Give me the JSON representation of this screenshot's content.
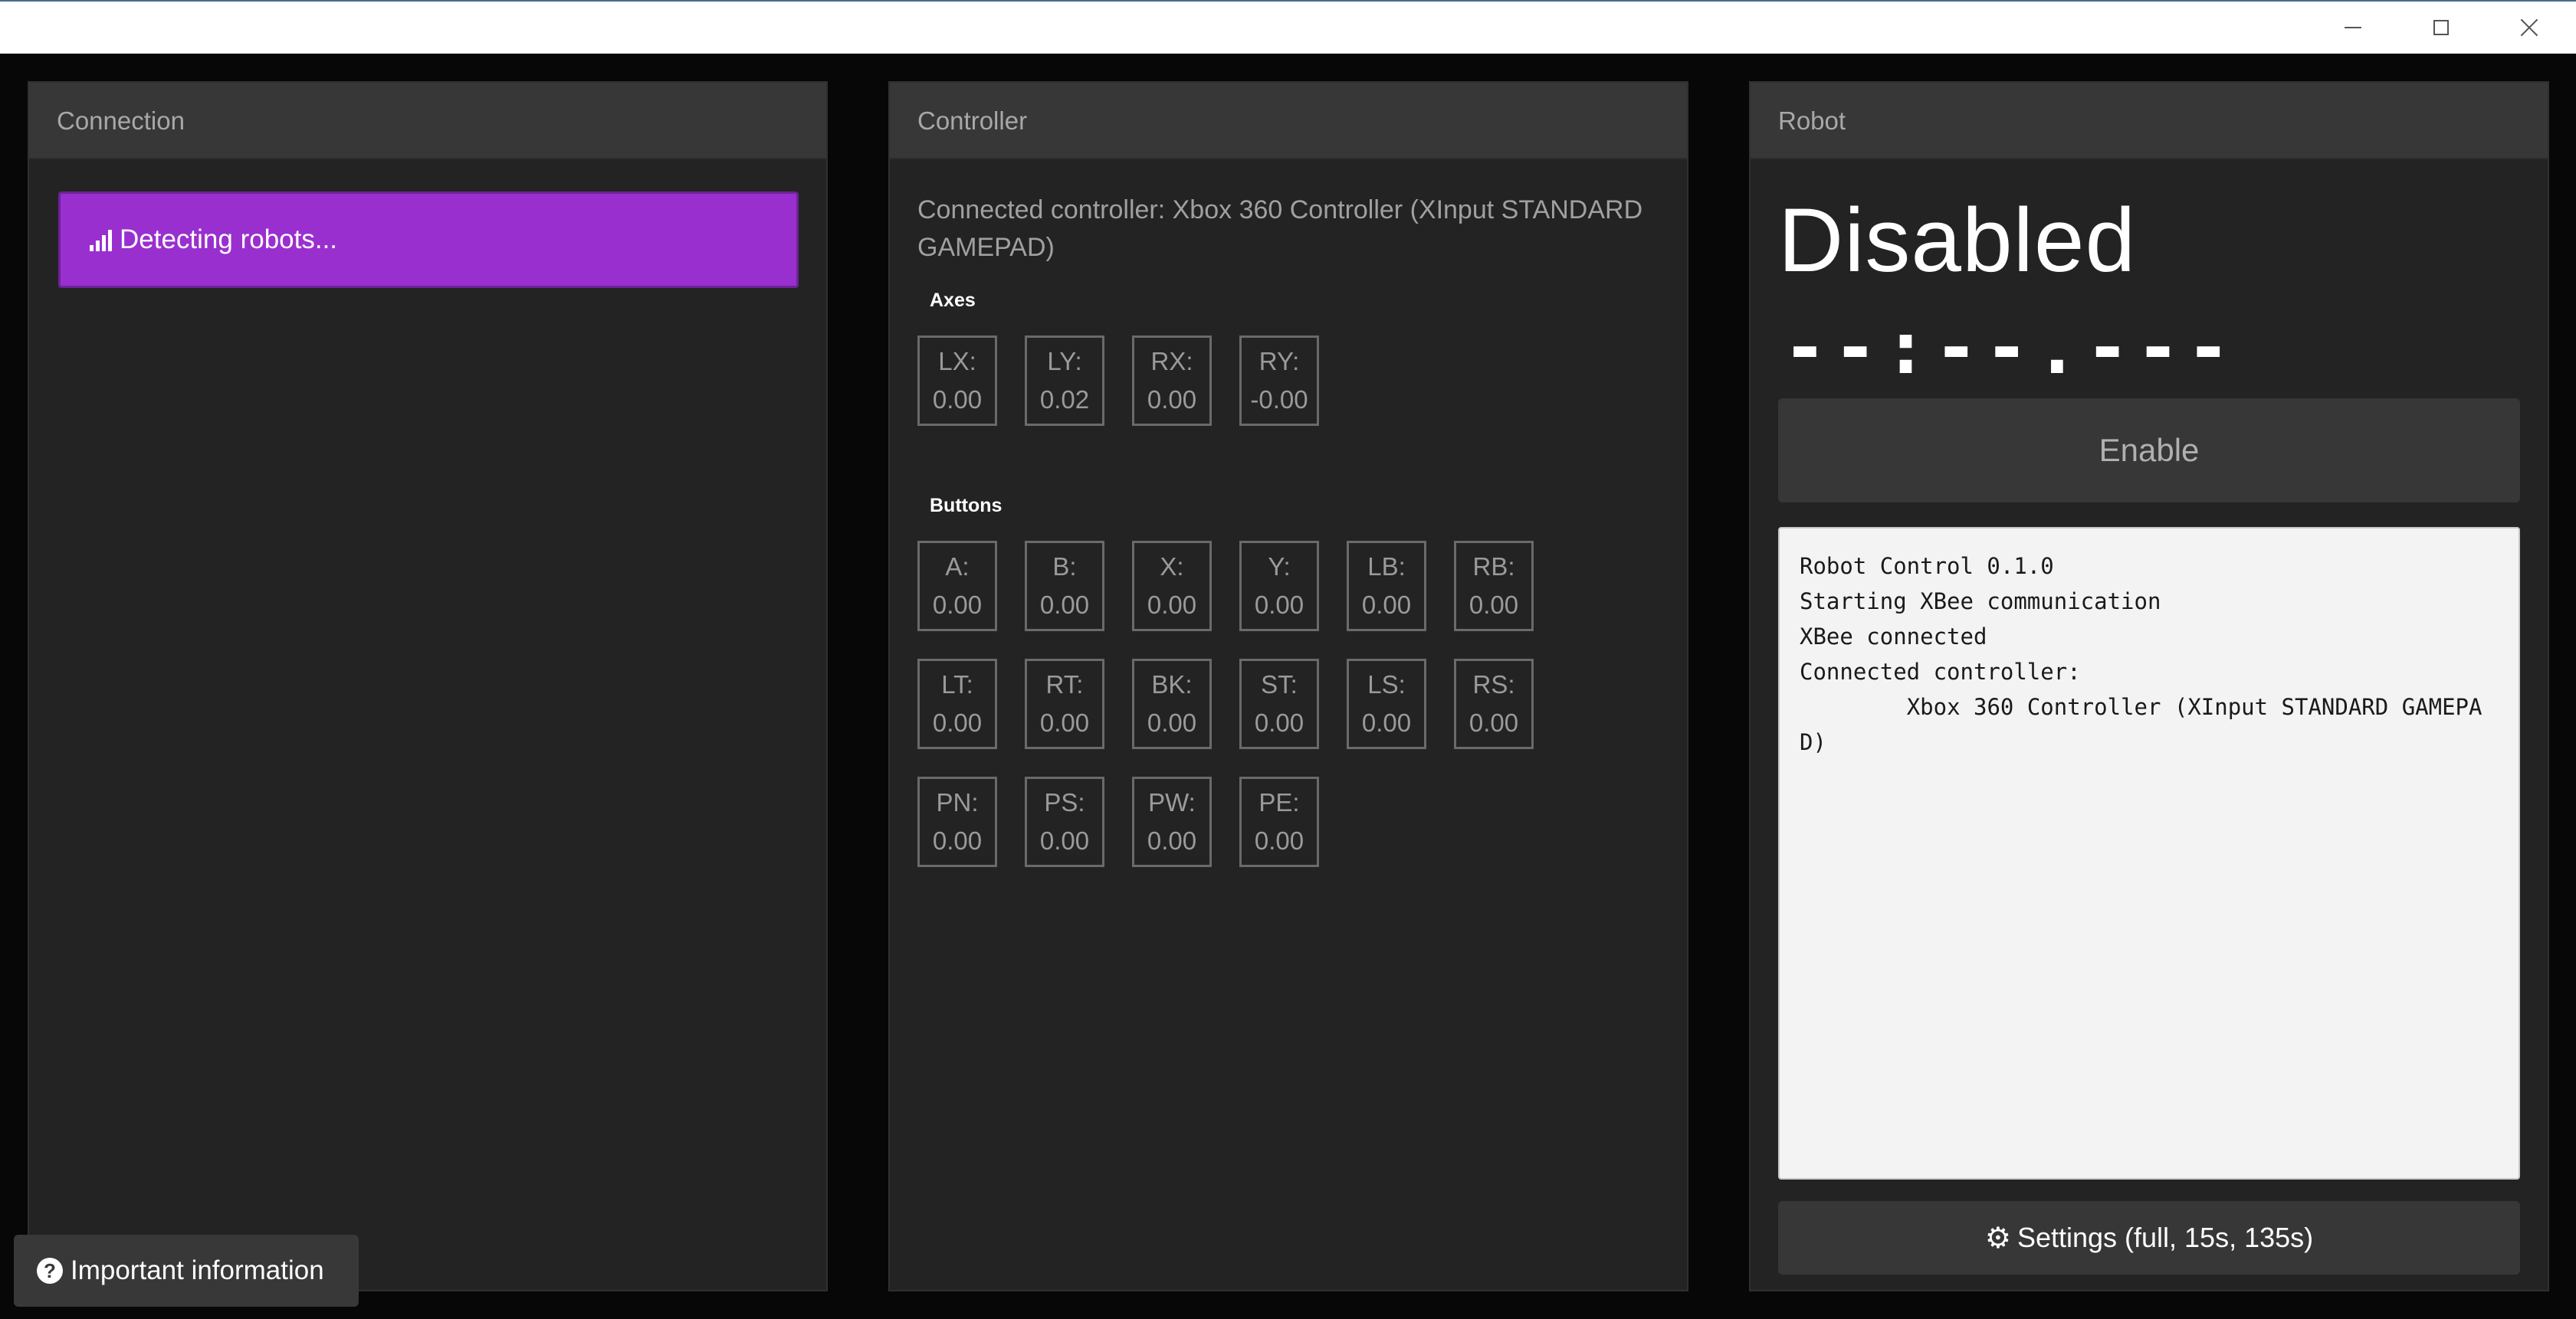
{
  "window": {
    "minimize_icon": "minimize-icon",
    "maximize_icon": "maximize-icon",
    "close_icon": "close-icon"
  },
  "connection": {
    "title": "Connection",
    "status_label": "Detecting robots...",
    "status_icon": "signal-bars-icon",
    "status_color": "#9a2fcf"
  },
  "controller": {
    "title": "Controller",
    "connected_text": "Connected controller: Xbox 360 Controller (XInput STANDARD GAMEPAD)",
    "axes_label": "Axes",
    "axes": [
      {
        "label": "LX:",
        "value": "0.00"
      },
      {
        "label": "LY:",
        "value": "0.02"
      },
      {
        "label": "RX:",
        "value": "0.00"
      },
      {
        "label": "RY:",
        "value": "-0.00"
      }
    ],
    "buttons_label": "Buttons",
    "buttons": [
      {
        "label": "A:",
        "value": "0.00"
      },
      {
        "label": "B:",
        "value": "0.00"
      },
      {
        "label": "X:",
        "value": "0.00"
      },
      {
        "label": "Y:",
        "value": "0.00"
      },
      {
        "label": "LB:",
        "value": "0.00"
      },
      {
        "label": "RB:",
        "value": "0.00"
      },
      {
        "label": "LT:",
        "value": "0.00"
      },
      {
        "label": "RT:",
        "value": "0.00"
      },
      {
        "label": "BK:",
        "value": "0.00"
      },
      {
        "label": "ST:",
        "value": "0.00"
      },
      {
        "label": "LS:",
        "value": "0.00"
      },
      {
        "label": "RS:",
        "value": "0.00"
      },
      {
        "label": "PN:",
        "value": "0.00"
      },
      {
        "label": "PS:",
        "value": "0.00"
      },
      {
        "label": "PW:",
        "value": "0.00"
      },
      {
        "label": "PE:",
        "value": "0.00"
      }
    ]
  },
  "robot": {
    "title": "Robot",
    "state": "Disabled",
    "timer": "--:--.---",
    "enable_label": "Enable",
    "log": [
      "Robot Control 0.1.0",
      "Starting XBee communication",
      "XBee connected",
      "Connected controller:",
      "        Xbox 360 Controller (XInput STANDARD GAMEPAD)"
    ],
    "settings_label": "Settings (full, 15s, 135s)",
    "settings_icon": "gear-icon"
  },
  "footer": {
    "info_label": "Important information",
    "info_icon": "question-circle-icon"
  }
}
